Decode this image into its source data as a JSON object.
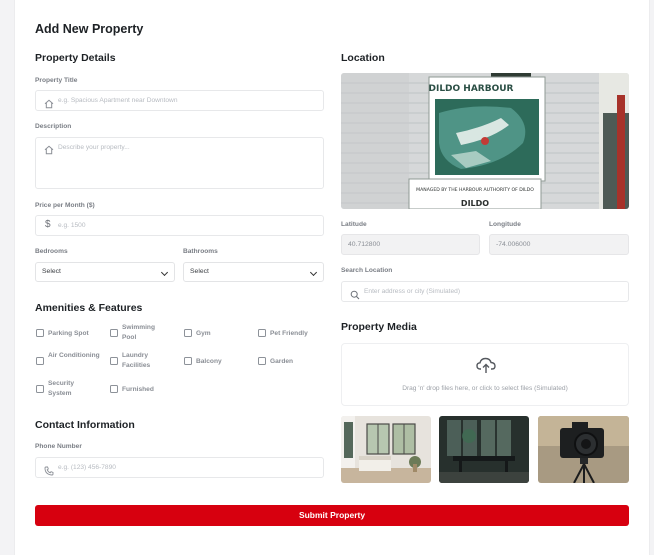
{
  "page": {
    "title": "Add New Property"
  },
  "details": {
    "section_title": "Property Details",
    "title_label": "Property Title",
    "title_placeholder": "e.g. Spacious Apartment near Downtown",
    "description_label": "Description",
    "description_placeholder": "Describe your property...",
    "price_label": "Price per Month ($)",
    "price_placeholder": "e.g. 1500",
    "bedrooms_label": "Bedrooms",
    "bedrooms_value": "Select",
    "bathrooms_label": "Bathrooms",
    "bathrooms_value": "Select"
  },
  "amenities": {
    "section_title": "Amenities & Features",
    "items": [
      {
        "label": "Parking Spot",
        "checked": false
      },
      {
        "label": "Swimming Pool",
        "checked": false
      },
      {
        "label": "Gym",
        "checked": false
      },
      {
        "label": "Pet Friendly",
        "checked": false
      },
      {
        "label": "Air Conditioning",
        "checked": false
      },
      {
        "label": "Laundry Facilities",
        "checked": false
      },
      {
        "label": "Balcony",
        "checked": false
      },
      {
        "label": "Garden",
        "checked": false
      },
      {
        "label": "Security System",
        "checked": false
      },
      {
        "label": "Furnished",
        "checked": false
      }
    ]
  },
  "contact": {
    "section_title": "Contact Information",
    "phone_label": "Phone Number",
    "phone_placeholder": "e.g. (123) 456-7890"
  },
  "location": {
    "section_title": "Location",
    "sign_line1": "DILDO HARBOUR",
    "sign_line2": "MANAGED BY THE HARBOUR AUTHORITY OF DILDO",
    "sign_line3": "DILDO",
    "latitude_label": "Latitude",
    "latitude_value": "40.712800",
    "longitude_label": "Longitude",
    "longitude_value": "-74.006000",
    "search_label": "Search Location",
    "search_placeholder": "Enter address or city (Simulated)"
  },
  "media": {
    "section_title": "Property Media",
    "drop_text": "Drag 'n' drop files here, or click to select files (Simulated)",
    "thumbnails": [
      "bedroom-photo",
      "dining-room-photo",
      "camera-photo"
    ]
  },
  "submit_label": "Submit Property",
  "colors": {
    "accent": "#d7000f",
    "text": "#1d2125",
    "muted": "#7a7e85",
    "border": "#e7e8ea"
  }
}
